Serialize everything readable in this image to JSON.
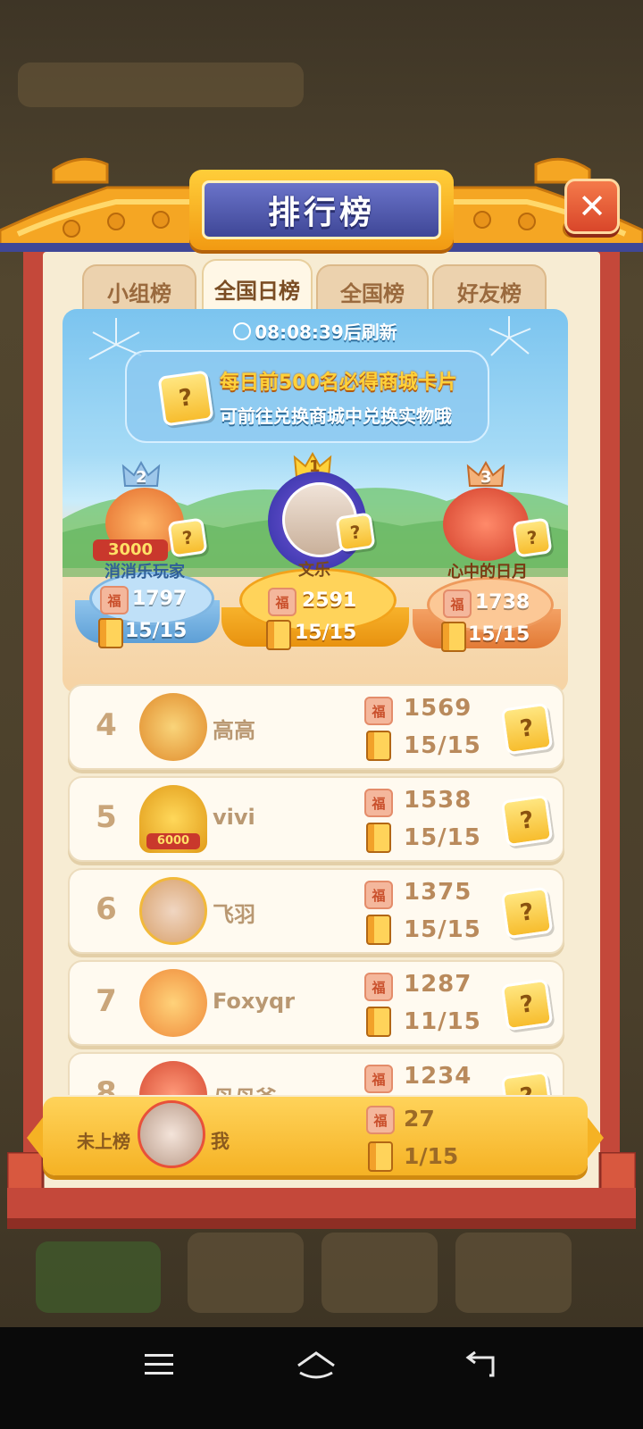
{
  "title": "排行榜",
  "tabs": [
    {
      "label": "小组榜",
      "active": false
    },
    {
      "label": "全国日榜",
      "active": true
    },
    {
      "label": "全国榜",
      "active": false
    },
    {
      "label": "好友榜",
      "active": false
    }
  ],
  "refresh_text": "08:08:39后刷新",
  "reward": {
    "line1": "每日前500名必得商城卡片",
    "line2": "可前往兑换商城中兑换实物哦"
  },
  "podium": [
    {
      "rank": "2",
      "name": "消消乐玩家",
      "score": "1797",
      "progress": "15/15",
      "badge": "3000"
    },
    {
      "rank": "1",
      "name": "文乐",
      "score": "2591",
      "progress": "15/15"
    },
    {
      "rank": "3",
      "name": "心中的日月",
      "score": "1738",
      "progress": "15/15"
    }
  ],
  "rows": [
    {
      "rank": "4",
      "name": "高高",
      "score": "1569",
      "progress": "15/15"
    },
    {
      "rank": "5",
      "name": "vivi",
      "score": "1538",
      "progress": "15/15",
      "badge": "6000"
    },
    {
      "rank": "6",
      "name": "飞羽",
      "score": "1375",
      "progress": "15/15"
    },
    {
      "rank": "7",
      "name": "Foxyqr",
      "score": "1287",
      "progress": "11/15"
    },
    {
      "rank": "8",
      "name": "母母爷",
      "score": "1234",
      "progress": ""
    }
  ],
  "me": {
    "rank_label": "未上榜",
    "name": "我",
    "score": "27",
    "progress": "1/15"
  },
  "icons": {
    "close": "close-icon",
    "clock": "clock-icon",
    "fu_score": "fu-token-icon",
    "book": "level-book-icon",
    "card": "mystery-card-icon",
    "nav": [
      "menu-icon",
      "home-icon",
      "back-icon"
    ]
  },
  "colors": {
    "frame_red": "#c4483a",
    "gold": "#f5b224",
    "plaque_blue": "#3f4797",
    "cream": "#f7ecd3"
  }
}
